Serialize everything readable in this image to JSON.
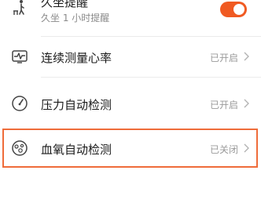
{
  "settings": {
    "sedentary": {
      "title": "久坐提醒",
      "subtitle": "久坐 1 小时提醒",
      "toggle_on": true,
      "icon": "sedentary-person-icon"
    },
    "heart_rate": {
      "title": "连续测量心率",
      "status": "已开启",
      "icon": "heart-rate-monitor-icon"
    },
    "stress": {
      "title": "压力自动检测",
      "status": "已开启",
      "icon": "gauge-icon"
    },
    "spo2": {
      "title": "血氧自动检测",
      "status": "已关闭",
      "icon": "blood-oxygen-icon",
      "highlighted": true
    }
  },
  "colors": {
    "accent": "#f05a22",
    "highlight_border": "#ef6c3a"
  }
}
